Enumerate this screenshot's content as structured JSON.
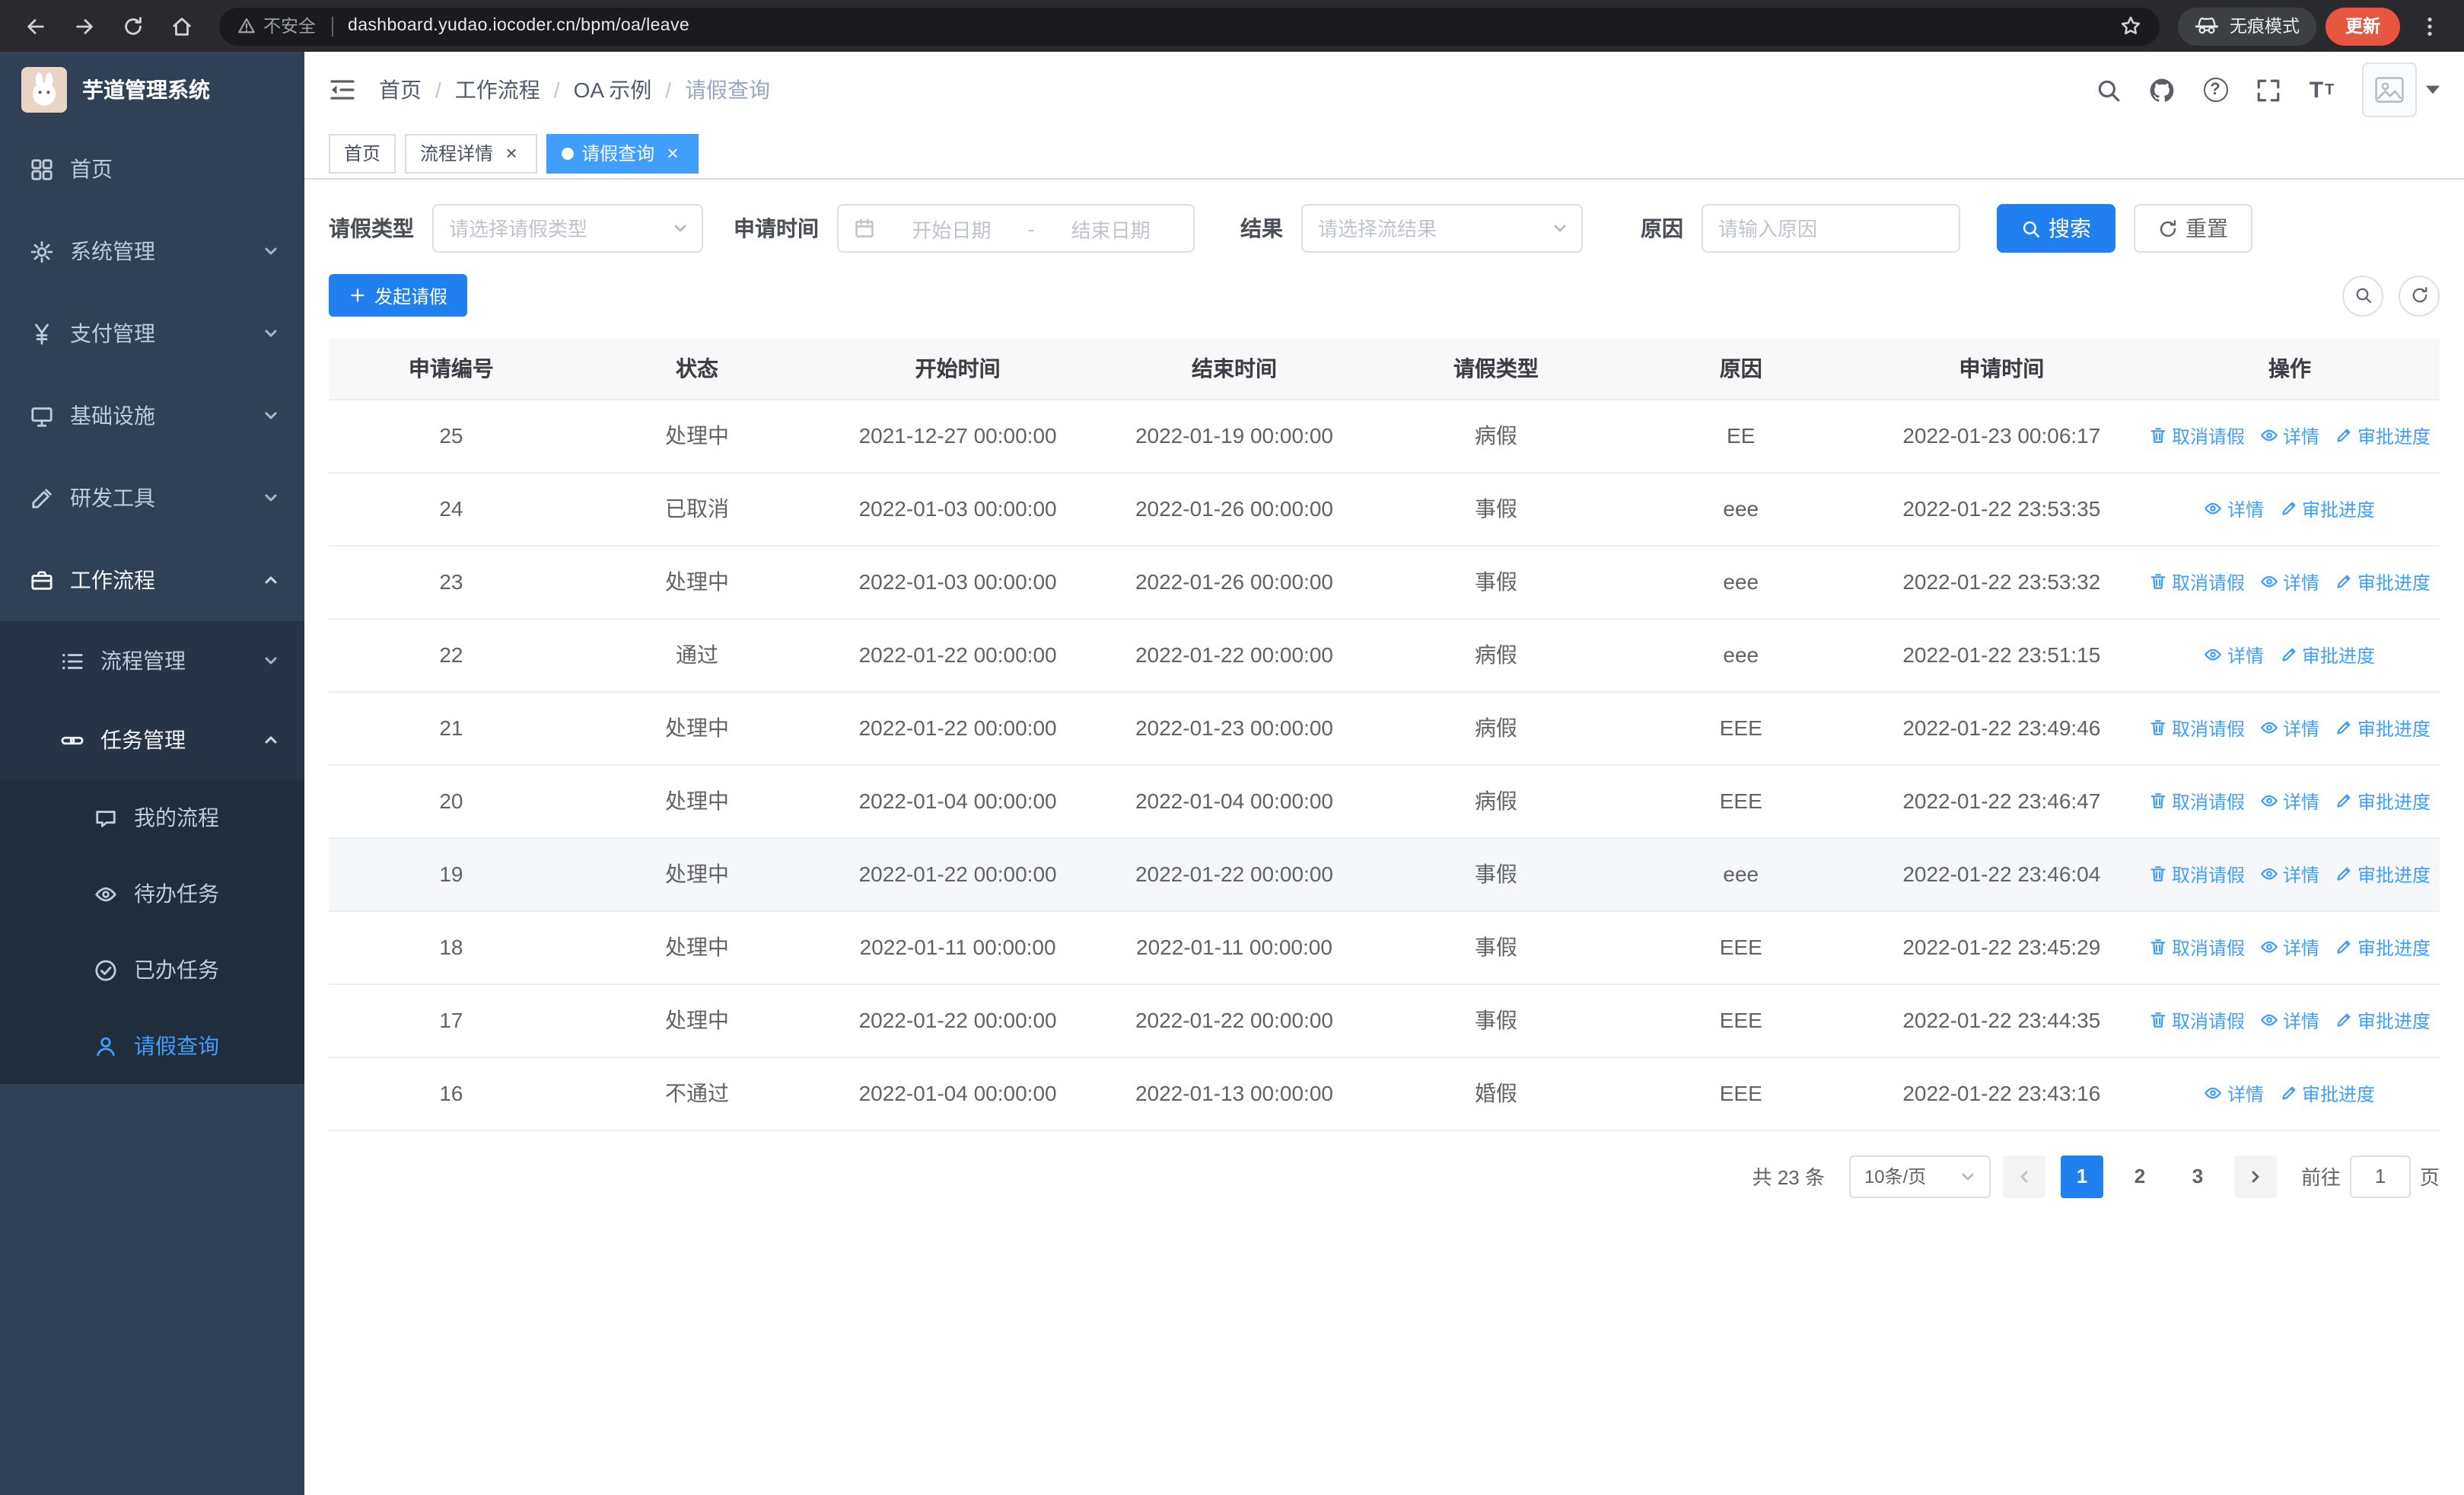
{
  "colors": {
    "primary": "#2080f0",
    "link": "#409eff",
    "sidebar_bg": "#304156",
    "sidebar_sub": "#263445",
    "sidebar_subsub": "#1f2d3d",
    "tag_active": "#409eff"
  },
  "browser": {
    "security_label": "不安全",
    "url": "dashboard.yudao.iocoder.cn/bpm/oa/leave",
    "incognito_label": "无痕模式",
    "update_label": "更新"
  },
  "sidebar": {
    "title": "芋道管理系统",
    "items": [
      {
        "label": "首页",
        "icon": "dashboard",
        "depth": 1
      },
      {
        "label": "系统管理",
        "icon": "gear",
        "depth": 1,
        "arrow": "down"
      },
      {
        "label": "支付管理",
        "icon": "yen",
        "depth": 1,
        "arrow": "down"
      },
      {
        "label": "基础设施",
        "icon": "infra",
        "depth": 1,
        "arrow": "down"
      },
      {
        "label": "研发工具",
        "icon": "tools",
        "depth": 1,
        "arrow": "down"
      },
      {
        "label": "工作流程",
        "icon": "briefcase",
        "depth": 1,
        "arrow": "up",
        "open": true
      },
      {
        "label": "流程管理",
        "icon": "process",
        "depth": 2,
        "arrow": "down"
      },
      {
        "label": "任务管理",
        "icon": "task",
        "depth": 2,
        "arrow": "up",
        "open": true
      },
      {
        "label": "我的流程",
        "icon": "chat",
        "depth": 3
      },
      {
        "label": "待办任务",
        "icon": "eye",
        "depth": 3
      },
      {
        "label": "已办任务",
        "icon": "check",
        "depth": 3
      },
      {
        "label": "请假查询",
        "icon": "user",
        "depth": 3,
        "active": true
      }
    ]
  },
  "breadcrumb": {
    "items": [
      "首页",
      "工作流程",
      "OA 示例",
      "请假查询"
    ]
  },
  "tags": [
    {
      "label": "首页",
      "active": false,
      "closable": false
    },
    {
      "label": "流程详情",
      "active": false,
      "closable": true
    },
    {
      "label": "请假查询",
      "active": true,
      "closable": true
    }
  ],
  "filters": {
    "leave_type_label": "请假类型",
    "leave_type_placeholder": "请选择请假类型",
    "apply_time_label": "申请时间",
    "start_date_placeholder": "开始日期",
    "range_separator": "-",
    "end_date_placeholder": "结束日期",
    "result_label": "结果",
    "result_placeholder": "请选择流结果",
    "reason_label": "原因",
    "reason_placeholder": "请输入原因",
    "search_label": "搜索",
    "reset_label": "重置"
  },
  "toolbar": {
    "create_label": "发起请假"
  },
  "table": {
    "headers": [
      "申请编号",
      "状态",
      "开始时间",
      "结束时间",
      "请假类型",
      "原因",
      "申请时间",
      "操作"
    ],
    "action_labels": {
      "cancel": "取消请假",
      "detail": "详情",
      "progress": "审批进度"
    },
    "rows": [
      {
        "id": "25",
        "status": "处理中",
        "start": "2021-12-27 00:00:00",
        "end": "2022-01-19 00:00:00",
        "type": "病假",
        "reason": "EE",
        "applied": "2022-01-23 00:06:17",
        "actions": [
          "cancel",
          "detail",
          "progress"
        ],
        "highlight": false
      },
      {
        "id": "24",
        "status": "已取消",
        "start": "2022-01-03 00:00:00",
        "end": "2022-01-26 00:00:00",
        "type": "事假",
        "reason": "eee",
        "applied": "2022-01-22 23:53:35",
        "actions": [
          "detail",
          "progress"
        ],
        "highlight": false
      },
      {
        "id": "23",
        "status": "处理中",
        "start": "2022-01-03 00:00:00",
        "end": "2022-01-26 00:00:00",
        "type": "事假",
        "reason": "eee",
        "applied": "2022-01-22 23:53:32",
        "actions": [
          "cancel",
          "detail",
          "progress"
        ],
        "highlight": false
      },
      {
        "id": "22",
        "status": "通过",
        "start": "2022-01-22 00:00:00",
        "end": "2022-01-22 00:00:00",
        "type": "病假",
        "reason": "eee",
        "applied": "2022-01-22 23:51:15",
        "actions": [
          "detail",
          "progress"
        ],
        "highlight": false
      },
      {
        "id": "21",
        "status": "处理中",
        "start": "2022-01-22 00:00:00",
        "end": "2022-01-23 00:00:00",
        "type": "病假",
        "reason": "EEE",
        "applied": "2022-01-22 23:49:46",
        "actions": [
          "cancel",
          "detail",
          "progress"
        ],
        "highlight": false
      },
      {
        "id": "20",
        "status": "处理中",
        "start": "2022-01-04 00:00:00",
        "end": "2022-01-04 00:00:00",
        "type": "病假",
        "reason": "EEE",
        "applied": "2022-01-22 23:46:47",
        "actions": [
          "cancel",
          "detail",
          "progress"
        ],
        "highlight": false
      },
      {
        "id": "19",
        "status": "处理中",
        "start": "2022-01-22 00:00:00",
        "end": "2022-01-22 00:00:00",
        "type": "事假",
        "reason": "eee",
        "applied": "2022-01-22 23:46:04",
        "actions": [
          "cancel",
          "detail",
          "progress"
        ],
        "highlight": true
      },
      {
        "id": "18",
        "status": "处理中",
        "start": "2022-01-11 00:00:00",
        "end": "2022-01-11 00:00:00",
        "type": "事假",
        "reason": "EEE",
        "applied": "2022-01-22 23:45:29",
        "actions": [
          "cancel",
          "detail",
          "progress"
        ],
        "highlight": false
      },
      {
        "id": "17",
        "status": "处理中",
        "start": "2022-01-22 00:00:00",
        "end": "2022-01-22 00:00:00",
        "type": "事假",
        "reason": "EEE",
        "applied": "2022-01-22 23:44:35",
        "actions": [
          "cancel",
          "detail",
          "progress"
        ],
        "highlight": false
      },
      {
        "id": "16",
        "status": "不通过",
        "start": "2022-01-04 00:00:00",
        "end": "2022-01-13 00:00:00",
        "type": "婚假",
        "reason": "EEE",
        "applied": "2022-01-22 23:43:16",
        "actions": [
          "detail",
          "progress"
        ],
        "highlight": false
      }
    ]
  },
  "pagination": {
    "total": "共 23 条",
    "page_size": "10条/页",
    "pages": [
      "1",
      "2",
      "3"
    ],
    "active": "1",
    "goto": "前往",
    "goto_value": "1",
    "unit": "页"
  }
}
